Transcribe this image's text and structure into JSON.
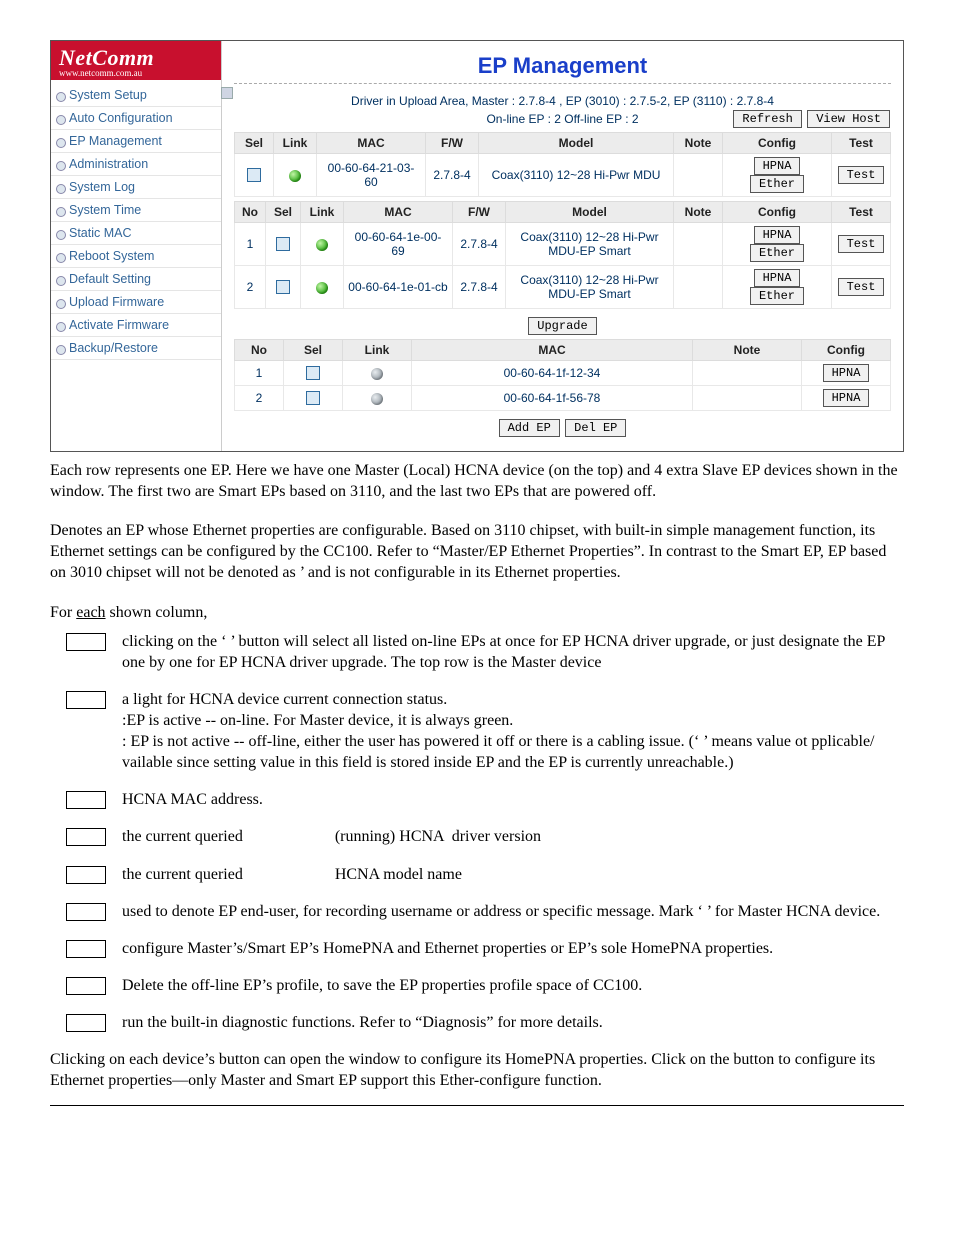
{
  "brand": {
    "name": "NetComm",
    "sub": "www.netcomm.com.au"
  },
  "nav": {
    "items": [
      "System Setup",
      "Auto Configuration",
      "EP Management",
      "Administration",
      "System Log",
      "System Time",
      "Static MAC",
      "Reboot System",
      "Default Setting",
      "Upload Firmware",
      "Activate Firmware",
      "Backup/Restore"
    ]
  },
  "panel": {
    "title": "EP Management",
    "driver_line": "Driver in Upload Area, Master : 2.7.8-4 ,   EP (3010) : 2.7.5-2,   EP (3110) : 2.7.8-4",
    "count_line": "On-line EP : 2    Off-line EP : 2",
    "buttons": {
      "refresh": "Refresh",
      "view_host": "View Host",
      "upgrade": "Upgrade",
      "add_ep": "Add EP",
      "del_ep": "Del EP"
    },
    "config_btn": {
      "hpna": "HPNA",
      "ether": "Ether",
      "test": "Test"
    },
    "t1": {
      "headers": [
        "Sel",
        "Link",
        "MAC",
        "F/W",
        "Model",
        "Note",
        "Config",
        "Test"
      ],
      "row": {
        "mac": "00-60-64-21-03-60",
        "fw": "2.7.8-4",
        "model": "Coax(3110) 12~28 Hi-Pwr MDU"
      }
    },
    "t2": {
      "headers": [
        "No",
        "Sel",
        "Link",
        "MAC",
        "F/W",
        "Model",
        "Note",
        "Config",
        "Test"
      ],
      "rows": [
        {
          "no": "1",
          "mac": "00-60-64-1e-00-69",
          "fw": "2.7.8-4",
          "model": "Coax(3110) 12~28 Hi-Pwr MDU-EP Smart"
        },
        {
          "no": "2",
          "mac": "00-60-64-1e-01-cb",
          "fw": "2.7.8-4",
          "model": "Coax(3110) 12~28 Hi-Pwr MDU-EP Smart"
        }
      ]
    },
    "t3": {
      "headers": [
        "No",
        "Sel",
        "Link",
        "MAC",
        "Note",
        "Config"
      ],
      "rows": [
        {
          "no": "1",
          "mac": "00-60-64-1f-12-34"
        },
        {
          "no": "2",
          "mac": "00-60-64-1f-56-78"
        }
      ]
    }
  },
  "prose": {
    "p1": "Each row represents one EP. Here we have one Master (Local) HCNA device (on the top) and 4 extra Slave EP devices shown in the window. The first two are Smart EPs based on 3110, and the last two EPs that are powered off.",
    "p2": "Denotes an EP whose Ethernet properties are configurable. Based on 3110 chipset, with built-in simple management function, its Ethernet settings can be configured by the CC100. Refer to “Master/EP Ethernet Properties”. In contrast to the Smart EP, EP based on 3010 chipset will not be denoted as             ’ and is not configurable in its Ethernet properties.",
    "lead": "For each shown column,",
    "items": {
      "sel": "clicking on the ‘    ’ button will select all listed on-line EPs at once for EP HCNA driver upgrade, or just designate the EP one by one for EP HCNA driver upgrade. The top row is the Master device",
      "link1": "a light for HCNA device current connection status.",
      "link2": ":EP is active -- on-line.  For Master device, it is always green.",
      "link3": ":  EP is not active -- off-line, either the user has powered it off or there is a cabling issue. (‘     ’ means value   ot   pplicable/  vailable since setting value in this field is stored inside EP and the EP is currently unreachable.)",
      "mac": "HCNA MAC address.",
      "fw": "the current queried                       (running) HCNA  driver version",
      "model": "the current queried                       HCNA model name",
      "note": "used to denote EP end-user, for recording username or address or specific message. Mark ‘         ’ for Master HCNA device.",
      "config": "configure Master’s/Smart EP’s HomePNA and Ethernet properties or EP’s sole HomePNA properties.",
      "del": "Delete the off-line EP’s profile, to save the EP properties profile space of CC100.",
      "test": "run the built-in diagnostic functions.  Refer to “Diagnosis” for more details."
    },
    "tail": "Clicking on each device’s               button can open the window to configure its HomePNA properties. Click on the                     button to configure its Ethernet properties—only Master and Smart EP support this Ether-configure function."
  }
}
